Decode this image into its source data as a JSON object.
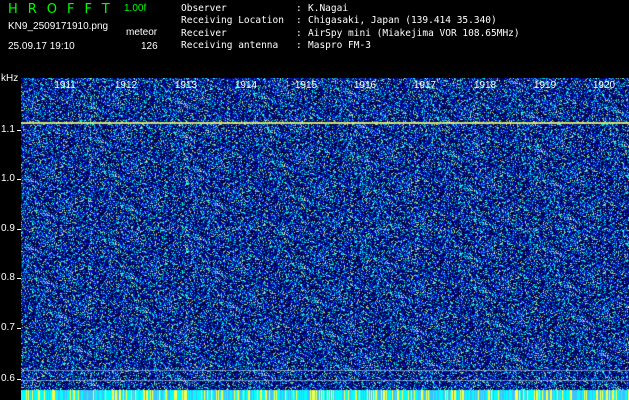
{
  "header": {
    "app_title": "HROFFT",
    "version": "1.00f",
    "filename": "KN9_2509171910.png",
    "mode": "meteor",
    "datetime": "25.09.17 19:10",
    "count": "126"
  },
  "info": {
    "rows": [
      {
        "key": "Observer",
        "sep": ":",
        "value": "K.Nagai"
      },
      {
        "key": "Receiving Location",
        "sep": ":",
        "value": "Chigasaki, Japan (139.414 35.340)"
      },
      {
        "key": "Receiver",
        "sep": ":",
        "value": "AirSpy mini (Miakejima VOR 108.65MHz)"
      },
      {
        "key": "Receiving antenna",
        "sep": ":",
        "value": "Maspro FM-3"
      }
    ]
  },
  "axis": {
    "unit": "kHz",
    "y_labels": [
      "1.1",
      "1.0",
      "0.9",
      "0.8",
      "0.7",
      "0.6"
    ],
    "y_values": [
      1.1,
      1.0,
      0.9,
      0.8,
      0.7,
      0.6
    ],
    "y_range": [
      0.58,
      1.17
    ],
    "time_labels": [
      "1911",
      "1912",
      "1913",
      "1914",
      "1915",
      "1916",
      "1917",
      "1918",
      "1919",
      "1920"
    ]
  },
  "colors": {
    "title": "#00ff00",
    "text": "#ffffff",
    "background": "#000000",
    "spectrogram_base": "#00004a",
    "carrier_line": "#f2ff6b",
    "bottom_band": "#00ffff"
  },
  "spectrogram": {
    "carrier_khz": 1.09
  }
}
